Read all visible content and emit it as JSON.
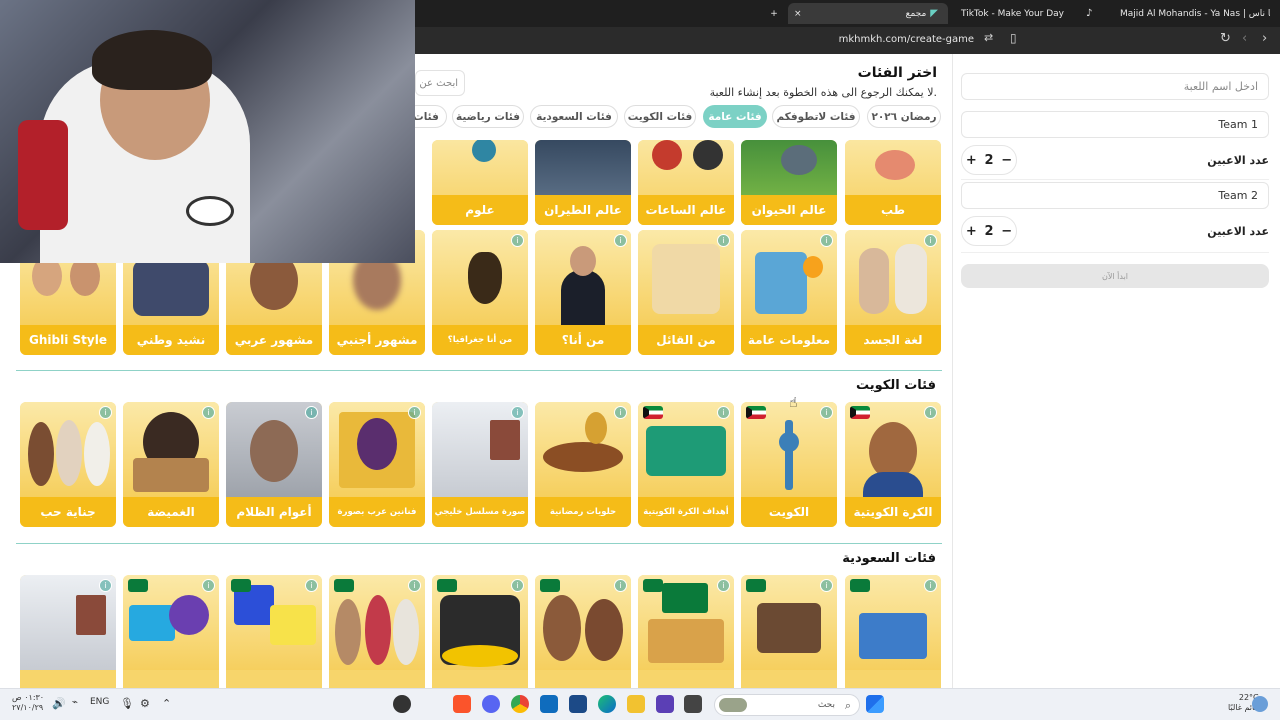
{
  "browser": {
    "tabs": [
      {
        "label": "مجمع",
        "active": true
      },
      {
        "label": "TikTok - Make Your Day",
        "active": false
      },
      {
        "label": "Majid Al Mohandis - Ya Nas | يا ناس -",
        "active": false
      }
    ],
    "new_tab": "+",
    "close_tab": "×",
    "url": "mkhmkh.com/create-game"
  },
  "setup": {
    "game_name_placeholder": "ادخل اسم اللعبة",
    "team1_name": "Team 1",
    "team2_name": "Team 2",
    "players_label": "عدد الاعبين",
    "team1_players": "2",
    "team2_players": "2",
    "plus": "+",
    "minus": "−",
    "start_label": "ابدأ الآن"
  },
  "categories": {
    "title": "اختر الفئات",
    "subtitle": "لا يمكنك الرجوع الى هذه الخطوة بعد إنشاء اللعبة.",
    "search_placeholder": "ابحث عن",
    "chips": [
      "رمضان ٢٠٢٦",
      "فئات لاتطوفكم",
      "فئات عامة",
      "فئات الكويت",
      "فئات السعودية",
      "فئات رياضية",
      "فئات"
    ],
    "active_chip": "فئات عامة",
    "row1": [
      "طب",
      "عالم الحيوان",
      "عالم الساعات",
      "عالم الطيران",
      "علوم"
    ],
    "row2": [
      "لغة الجسد",
      "معلومات عامة",
      "من القائل",
      "من أنا؟",
      "من أنا جغرافيا؟",
      "مشهور أجنبي",
      "مشهور عربي",
      "نشيد وطني",
      "Ghibli Style"
    ],
    "kuwait_title": "فئات الكويت",
    "kuwait": [
      "الكرة الكويتية",
      "الكويت",
      "أهداف الكرة الكويتية",
      "حلويات رمضانية",
      "صورة مسلسل خليجي",
      "فنانين عرب بصورة",
      "أعوام الظلام",
      "الغميضة",
      "جناية حب"
    ],
    "saudi_title": "فئات السعودية",
    "info_glyph": "i"
  },
  "taskbar": {
    "time": "٠١:٣٠ ص",
    "date": "٢٧/١٠/٢٩",
    "lang": "ENG",
    "search_label": "بحث",
    "weather_temp": "22°C",
    "weather_desc": "غائم غالبًا"
  },
  "colors": {
    "card_yellow": "#f5bc18",
    "active_chip": "#7cd1c5",
    "section_line": "#8fd2c7"
  }
}
